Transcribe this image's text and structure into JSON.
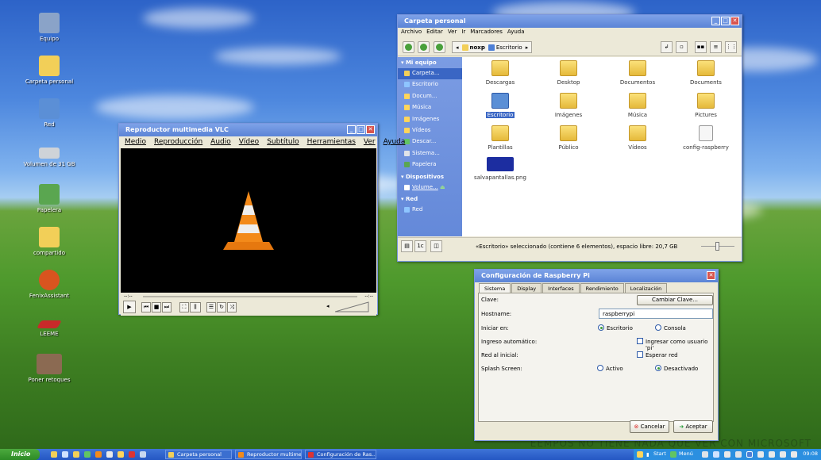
{
  "desktop": {
    "icons": [
      {
        "label": "Equipo",
        "color": "#8aa3c8"
      },
      {
        "label": "Carpeta personal",
        "color": "#f2cf58"
      },
      {
        "label": "Red",
        "color": "#5b8fd6"
      },
      {
        "label": "Volumen de 31 GB",
        "color": "#cfd3d8"
      },
      {
        "label": "Papelera",
        "color": "#5aa650"
      },
      {
        "label": "compartido",
        "color": "#f2cf58"
      },
      {
        "label": "FenixAssistant",
        "color": "#d9541f"
      },
      {
        "label": "LEEME",
        "color": "#c92a2a"
      },
      {
        "label": "Poner retoques",
        "color": "#8b6a52"
      }
    ],
    "watermark": "EEMPOS NO TIENE NADA QUE VER CON MICROSOFT"
  },
  "file_manager": {
    "title": "Carpeta personal",
    "menu": [
      "Archivo",
      "Editar",
      "Ver",
      "Ir",
      "Marcadores",
      "Ayuda"
    ],
    "path": [
      "noxp",
      "Escritorio"
    ],
    "sidebar": {
      "sections": [
        {
          "head": "Mi equipo",
          "items": [
            "Carpeta...",
            "Escritorio",
            "Docum...",
            "Música",
            "Imágenes",
            "Vídeos",
            "Descar...",
            "Sistema...",
            "Papelera"
          ]
        },
        {
          "head": "Dispositivos",
          "items": [
            "Volume..."
          ]
        },
        {
          "head": "Red",
          "items": [
            "Red"
          ]
        }
      ]
    },
    "files": [
      {
        "name": "Descargas",
        "kind": "folder"
      },
      {
        "name": "Desktop",
        "kind": "folder"
      },
      {
        "name": "Documentos",
        "kind": "folder"
      },
      {
        "name": "Documents",
        "kind": "folder"
      },
      {
        "name": "Escritorio",
        "kind": "desktop"
      },
      {
        "name": "Imágenes",
        "kind": "folder"
      },
      {
        "name": "Música",
        "kind": "folder"
      },
      {
        "name": "Pictures",
        "kind": "folder"
      },
      {
        "name": "Plantillas",
        "kind": "folder"
      },
      {
        "name": "Público",
        "kind": "folder"
      },
      {
        "name": "Vídeos",
        "kind": "folder"
      },
      {
        "name": "config-raspberry",
        "kind": "file"
      },
      {
        "name": "salvapantallas.png",
        "kind": "image"
      }
    ],
    "status": "«Escritorio» seleccionado (contiene 6 elementos), espacio libre: 20,7 GB",
    "status_buttons": [
      "1c"
    ]
  },
  "vlc": {
    "title": "Reproductor multimedia VLC",
    "menu": [
      "Medio",
      "Reproducción",
      "Audio",
      "Vídeo",
      "Subtítulo",
      "Herramientas",
      "Ver",
      "Ayuda"
    ],
    "time_left": "--:--",
    "time_right": "--:--"
  },
  "raspi": {
    "title": "Configuración de Raspberry Pi",
    "tabs": [
      "Sistema",
      "Display",
      "Interfaces",
      "Rendimiento",
      "Localización"
    ],
    "rows": {
      "clave": "Clave:",
      "cambiar": "Cambiar Clave...",
      "hostname_label": "Hostname:",
      "hostname_value": "raspberrypi",
      "iniciar": "Iniciar en:",
      "escritorio": "Escritorio",
      "consola": "Consola",
      "ingreso": "Ingreso automático:",
      "ingreso_opt": "Ingresar como usuario 'pi'",
      "red": "Red al inicial:",
      "red_opt": "Esperar red",
      "splash": "Splash Screen:",
      "activo": "Activo",
      "desactivado": "Desactivado"
    },
    "cancel": "Cancelar",
    "accept": "Aceptar"
  },
  "taskbar": {
    "start": "Inicio",
    "tasks": [
      "Carpeta personal",
      "Reproductor multime...",
      "Configuración de Ras..."
    ],
    "tray_start": "Start",
    "tray_menu": "Menú",
    "clock": "09:08"
  }
}
